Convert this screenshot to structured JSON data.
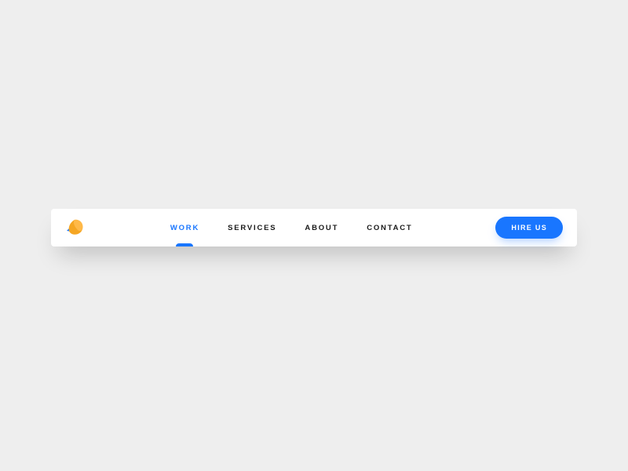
{
  "colors": {
    "accent": "#1976ff",
    "logo_primary": "#f5a623",
    "logo_secondary": "#1976ff",
    "background": "#eeeeee",
    "navbar_bg": "#ffffff",
    "text": "#1a1a1a"
  },
  "nav": {
    "items": [
      {
        "label": "WORK",
        "active": true
      },
      {
        "label": "SERVICES",
        "active": false
      },
      {
        "label": "ABOUT",
        "active": false
      },
      {
        "label": "CONTACT",
        "active": false
      }
    ]
  },
  "cta": {
    "label": "HIRE US"
  }
}
